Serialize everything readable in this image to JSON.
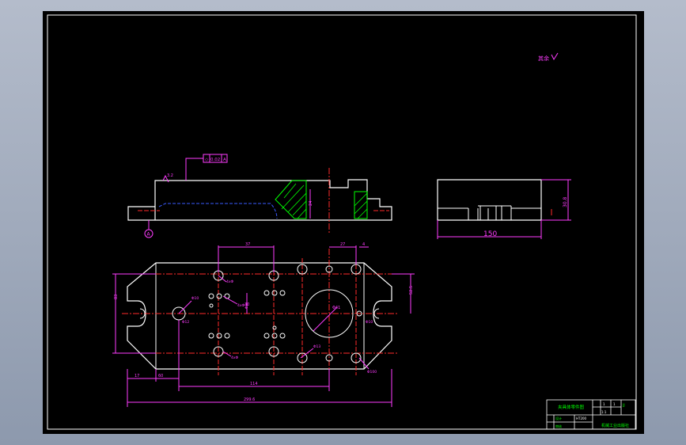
{
  "drawing": {
    "roughness_mark": "其余",
    "top_view_dims": {
      "d37": "37",
      "d27": "27",
      "d4": "4",
      "d83": "83",
      "d52": "52.5",
      "d30": "30",
      "d83b": "83",
      "d17": "17",
      "d60": "60",
      "d114": "114",
      "d299": "299.6",
      "phi10": "Φ10",
      "phi12": "Φ12",
      "phi8": "Φ8",
      "phi10b": "Φ10",
      "phi41": "Φ41",
      "phi13": "Φ13",
      "phi100": "Φ100",
      "hole_label_a": "4xΦ",
      "hole_label_b": "4xΦ",
      "hole_label_c": "4xΦ"
    },
    "side_view_dims": {
      "width": "150",
      "height": "30.8"
    },
    "front_view": {
      "flatness": "0.02",
      "datum": "A",
      "datum_marker": "A",
      "roughness": "3.2",
      "depth": "24"
    },
    "title_block": {
      "drawing_title": "夹具体零件图",
      "material": "HT200",
      "scale": "1:1",
      "drawing_no": "JJ",
      "school": "机械工业出版社",
      "designer": "设计",
      "checker": "审核",
      "qty": "1",
      "sheet": "1"
    }
  }
}
